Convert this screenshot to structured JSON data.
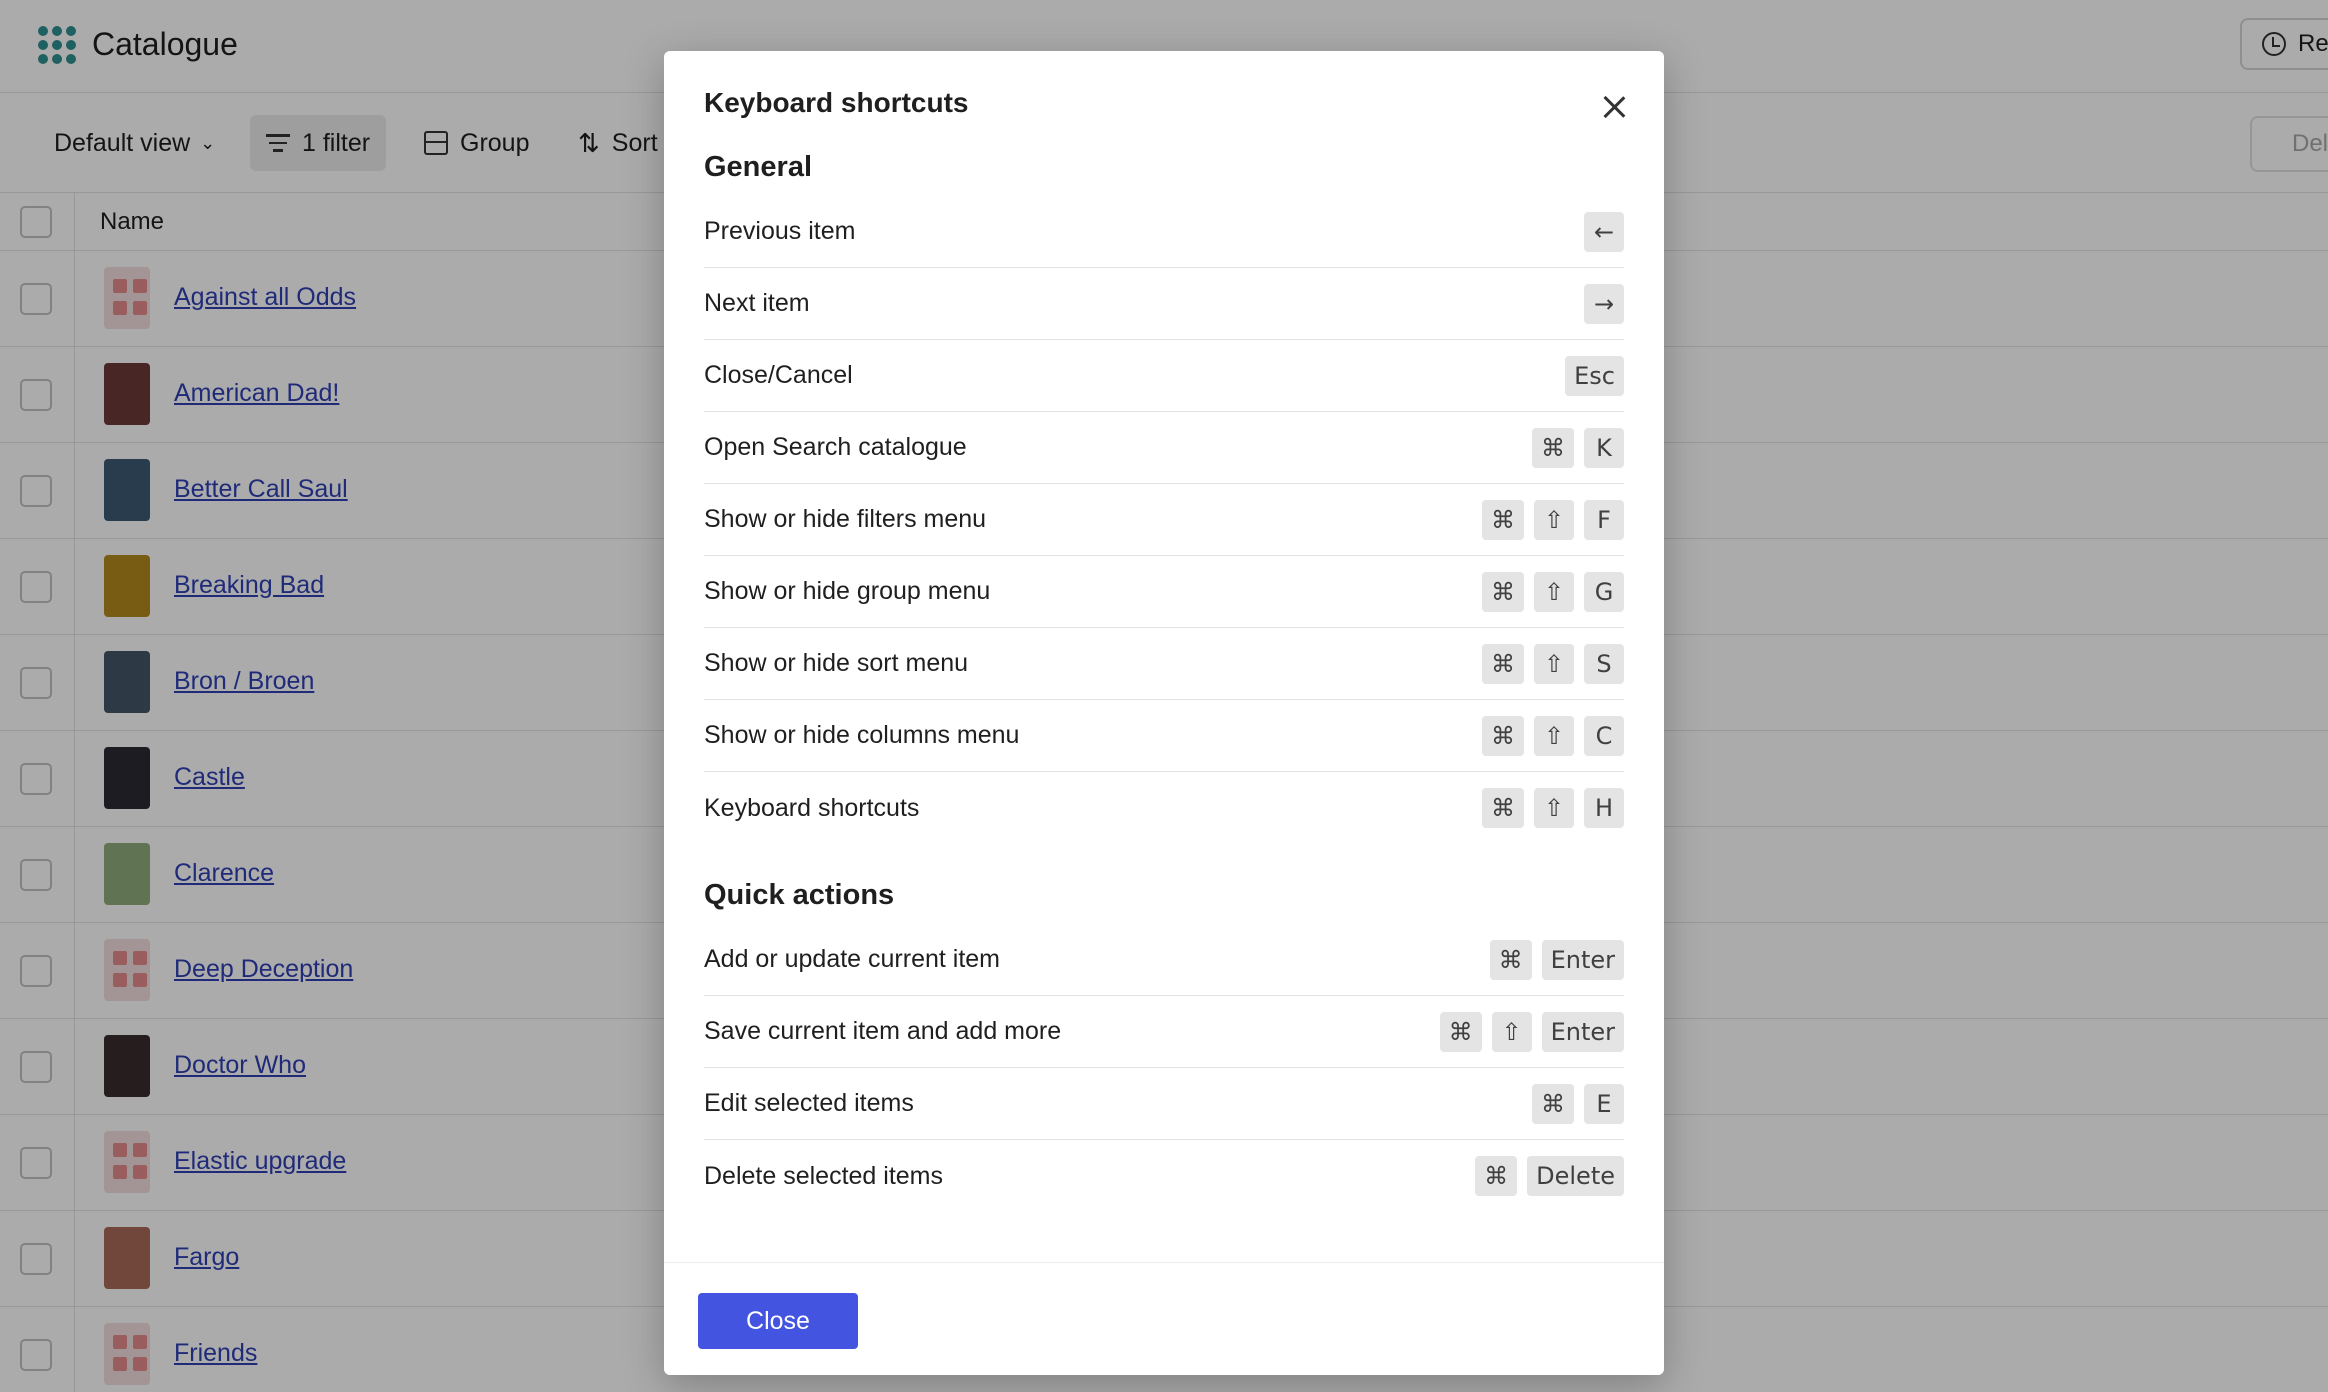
{
  "app": {
    "title": "Catalogue",
    "recent_label": "Re"
  },
  "toolbar": {
    "view_label": "Default view",
    "filter_label": "1 filter",
    "group_label": "Group",
    "sort_label": "Sort",
    "delete_label": "Del"
  },
  "table": {
    "name_header": "Name",
    "rows": [
      {
        "title": "Against all Odds",
        "thumb": "placeholder"
      },
      {
        "title": "American Dad!",
        "thumb": "#6c3a3a"
      },
      {
        "title": "Better Call Saul",
        "thumb": "#3d5a73"
      },
      {
        "title": "Breaking Bad",
        "thumb": "#b58a1e"
      },
      {
        "title": "Bron / Broen",
        "thumb": "#445566"
      },
      {
        "title": "Castle",
        "thumb": "#2b2b33"
      },
      {
        "title": "Clarence",
        "thumb": "#8fae7c"
      },
      {
        "title": "Deep Deception",
        "thumb": "placeholder"
      },
      {
        "title": "Doctor Who",
        "thumb": "#3a2e2e"
      },
      {
        "title": "Elastic upgrade",
        "thumb": "placeholder"
      },
      {
        "title": "Fargo",
        "thumb": "#a96a5a"
      },
      {
        "title": "Friends",
        "thumb": "placeholder"
      }
    ]
  },
  "modal": {
    "title": "Keyboard shortcuts",
    "close_button_label": "Close",
    "sections": [
      {
        "title": "General",
        "shortcuts": [
          {
            "label": "Previous item",
            "keys": [
              "←"
            ]
          },
          {
            "label": "Next item",
            "keys": [
              "→"
            ]
          },
          {
            "label": "Close/Cancel",
            "keys": [
              "Esc"
            ]
          },
          {
            "label": "Open Search catalogue",
            "keys": [
              "⌘",
              "K"
            ]
          },
          {
            "label": "Show or hide filters menu",
            "keys": [
              "⌘",
              "⇧",
              "F"
            ]
          },
          {
            "label": "Show or hide group menu",
            "keys": [
              "⌘",
              "⇧",
              "G"
            ]
          },
          {
            "label": "Show or hide sort menu",
            "keys": [
              "⌘",
              "⇧",
              "S"
            ]
          },
          {
            "label": "Show or hide columns menu",
            "keys": [
              "⌘",
              "⇧",
              "C"
            ]
          },
          {
            "label": "Keyboard shortcuts",
            "keys": [
              "⌘",
              "⇧",
              "H"
            ]
          }
        ]
      },
      {
        "title": "Quick actions",
        "shortcuts": [
          {
            "label": "Add or update current item",
            "keys": [
              "⌘",
              "Enter"
            ]
          },
          {
            "label": "Save current item and add more",
            "keys": [
              "⌘",
              "⇧",
              "Enter"
            ]
          },
          {
            "label": "Edit selected items",
            "keys": [
              "⌘",
              "E"
            ]
          },
          {
            "label": "Delete selected items",
            "keys": [
              "⌘",
              "Delete"
            ]
          }
        ]
      }
    ]
  },
  "colors": {
    "accent": "#4355e0",
    "link": "#2f3fb5",
    "logo": "#2f8f8f"
  }
}
